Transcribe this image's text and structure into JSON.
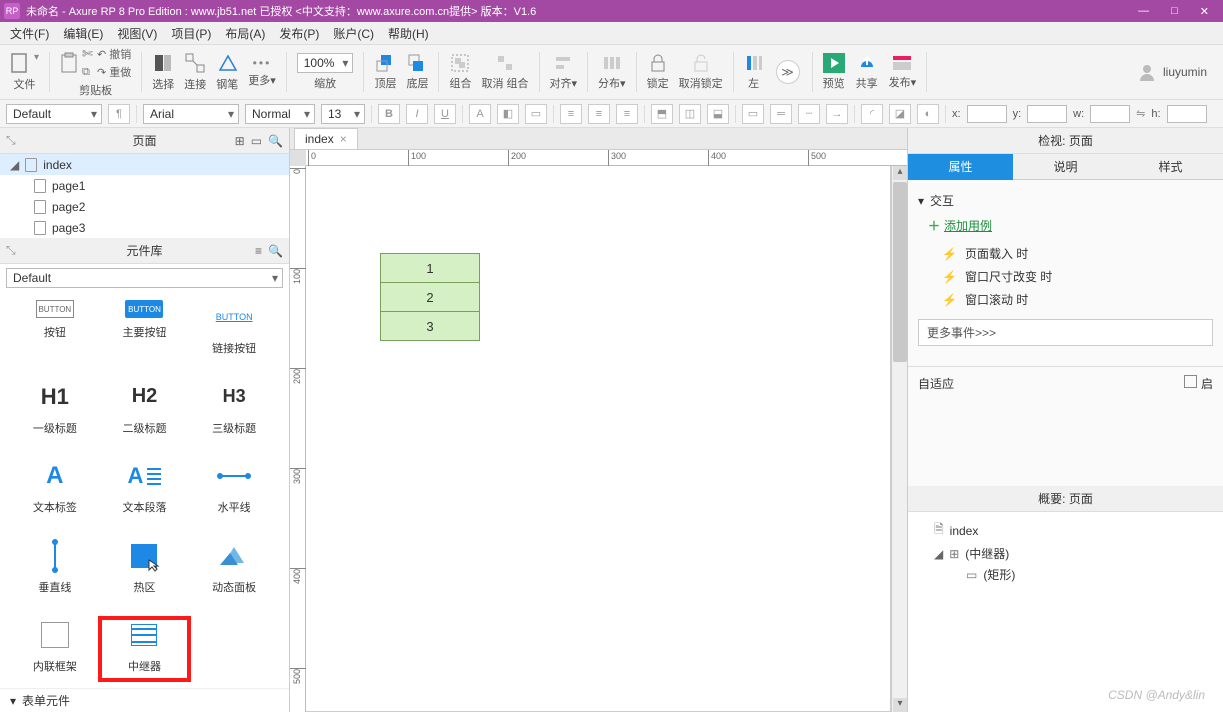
{
  "titlebar": {
    "logo": "RP",
    "text": "未命名 - Axure RP 8 Pro Edition : www.jb51.net 已授权     <中文支持：www.axure.com.cn提供>  版本：V1.6"
  },
  "menubar": [
    "文件(F)",
    "编辑(E)",
    "视图(V)",
    "项目(P)",
    "布局(A)",
    "发布(P)",
    "账户(C)",
    "帮助(H)"
  ],
  "toolbar": {
    "file_lbl": "文件",
    "clip_lbl": "剪贴板",
    "undo": "↶ 撤销",
    "redo": "↷ 重做",
    "select": "选择",
    "connect": "连接",
    "pen": "钢笔",
    "more": "更多▾",
    "zoom": "100%",
    "zoom_lbl": "缩放",
    "top": "顶层",
    "bottom": "底层",
    "group": "组合",
    "ungroup": "取消 组合",
    "align": "对齐▾",
    "distribute": "分布▾",
    "lock": "锁定",
    "unlock": "取消锁定",
    "left": "左",
    "preview": "预览",
    "share": "共享",
    "publish": "发布▾",
    "user": "liuyumin"
  },
  "formatbar": {
    "style": "Default",
    "font": "Arial",
    "weight": "Normal",
    "size": "13",
    "x": "x:",
    "y": "y:",
    "w": "w:",
    "h": "h:",
    "wv": "",
    "hv": "",
    "xv": "",
    "yv": ""
  },
  "pages": {
    "title": "页面",
    "items": [
      {
        "label": "index",
        "level": 0,
        "expanded": true,
        "selected": true
      },
      {
        "label": "page1",
        "level": 1
      },
      {
        "label": "page2",
        "level": 1
      },
      {
        "label": "page3",
        "level": 1
      }
    ]
  },
  "library": {
    "title": "元件库",
    "dropdown": "Default",
    "widgets": [
      {
        "label": "按钮",
        "icon": "btn-box",
        "txt": "BUTTON"
      },
      {
        "label": "主要按钮",
        "icon": "btn-primary",
        "txt": "BUTTON"
      },
      {
        "label": "链接按钮",
        "icon": "btn-link",
        "txt": "BUTTON"
      },
      {
        "label": "一级标题",
        "icon": "h1",
        "txt": "H1"
      },
      {
        "label": "二级标题",
        "icon": "h2",
        "txt": "H2"
      },
      {
        "label": "三级标题",
        "icon": "h3",
        "txt": "H3"
      },
      {
        "label": "文本标签",
        "icon": "txt-a",
        "txt": "A"
      },
      {
        "label": "文本段落",
        "icon": "para",
        "txt": "A"
      },
      {
        "label": "水平线",
        "icon": "hline"
      },
      {
        "label": "垂直线",
        "icon": "vline"
      },
      {
        "label": "热区",
        "icon": "hot"
      },
      {
        "label": "动态面板",
        "icon": "dyn"
      },
      {
        "label": "内联框架",
        "icon": "frame"
      },
      {
        "label": "中继器",
        "icon": "repeater",
        "highlight": true
      }
    ],
    "form_section": "表单元件"
  },
  "canvas": {
    "tab": "index",
    "ruler_h": [
      0,
      100,
      200,
      300,
      400,
      500
    ],
    "ruler_v": [
      0,
      100,
      200,
      300,
      400,
      500
    ],
    "repeater": [
      "1",
      "2",
      "3"
    ]
  },
  "inspector": {
    "title": "检视: 页面",
    "tabs": [
      "属性",
      "说明",
      "样式"
    ],
    "section": "交互",
    "add_case": "添加用例",
    "events": [
      "页面载入 时",
      "窗口尺寸改变 时",
      "窗口滚动 时"
    ],
    "more_events": "更多事件>>>",
    "adaptive": "自适应",
    "adaptive_chk": "启"
  },
  "outline": {
    "title": "概要: 页面",
    "items": [
      {
        "label": "index",
        "level": 0
      },
      {
        "label": "(中继器)",
        "level": 1,
        "expanded": true,
        "icon": "rep"
      },
      {
        "label": "(矩形)",
        "level": 2,
        "icon": "rect"
      }
    ]
  },
  "watermark": "CSDN @Andy&lin"
}
